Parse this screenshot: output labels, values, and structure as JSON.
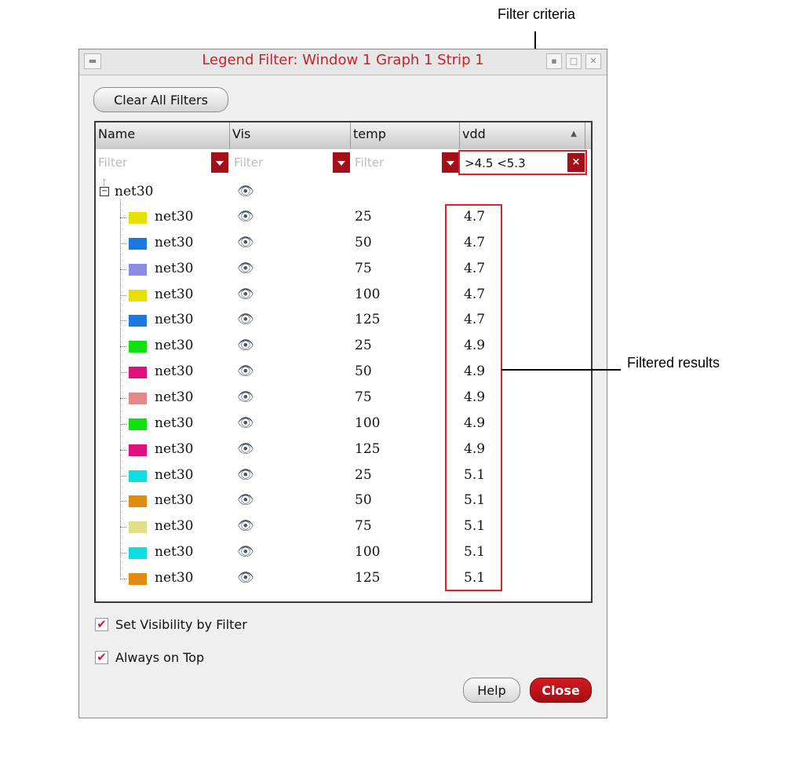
{
  "callouts": {
    "filter_criteria": "Filter criteria",
    "filtered_results": "Filtered results"
  },
  "window": {
    "title": "Legend Filter: Window 1 Graph 1 Strip 1",
    "clear_all_label": "Clear All Filters",
    "help_label": "Help",
    "close_label": "Close"
  },
  "table": {
    "headers": [
      "Name",
      "Vis",
      "temp",
      "vdd"
    ],
    "filter_placeholder": "Filter",
    "vdd_filter_value": ">4.5 <5.3",
    "parent": "net30",
    "rows": [
      {
        "color": "#e4e000",
        "name": "net30",
        "temp": "25",
        "vdd": "4.7"
      },
      {
        "color": "#1a78de",
        "name": "net30",
        "temp": "50",
        "vdd": "4.7"
      },
      {
        "color": "#8d8ce0",
        "name": "net30",
        "temp": "75",
        "vdd": "4.7"
      },
      {
        "color": "#e4e000",
        "name": "net30",
        "temp": "100",
        "vdd": "4.7"
      },
      {
        "color": "#1a78de",
        "name": "net30",
        "temp": "125",
        "vdd": "4.7"
      },
      {
        "color": "#10e010",
        "name": "net30",
        "temp": "25",
        "vdd": "4.9"
      },
      {
        "color": "#e0107a",
        "name": "net30",
        "temp": "50",
        "vdd": "4.9"
      },
      {
        "color": "#e08a8a",
        "name": "net30",
        "temp": "75",
        "vdd": "4.9"
      },
      {
        "color": "#10e010",
        "name": "net30",
        "temp": "100",
        "vdd": "4.9"
      },
      {
        "color": "#e0107a",
        "name": "net30",
        "temp": "125",
        "vdd": "4.9"
      },
      {
        "color": "#10dede",
        "name": "net30",
        "temp": "25",
        "vdd": "5.1"
      },
      {
        "color": "#e08a10",
        "name": "net30",
        "temp": "50",
        "vdd": "5.1"
      },
      {
        "color": "#e0e08a",
        "name": "net30",
        "temp": "75",
        "vdd": "5.1"
      },
      {
        "color": "#10dede",
        "name": "net30",
        "temp": "100",
        "vdd": "5.1"
      },
      {
        "color": "#e08a10",
        "name": "net30",
        "temp": "125",
        "vdd": "5.1"
      }
    ]
  },
  "options": {
    "set_visibility": "Set Visibility by Filter",
    "always_on_top": "Always on Top"
  },
  "colors": {
    "accent_red": "#c8232c",
    "callout_red": "#e0202a"
  }
}
